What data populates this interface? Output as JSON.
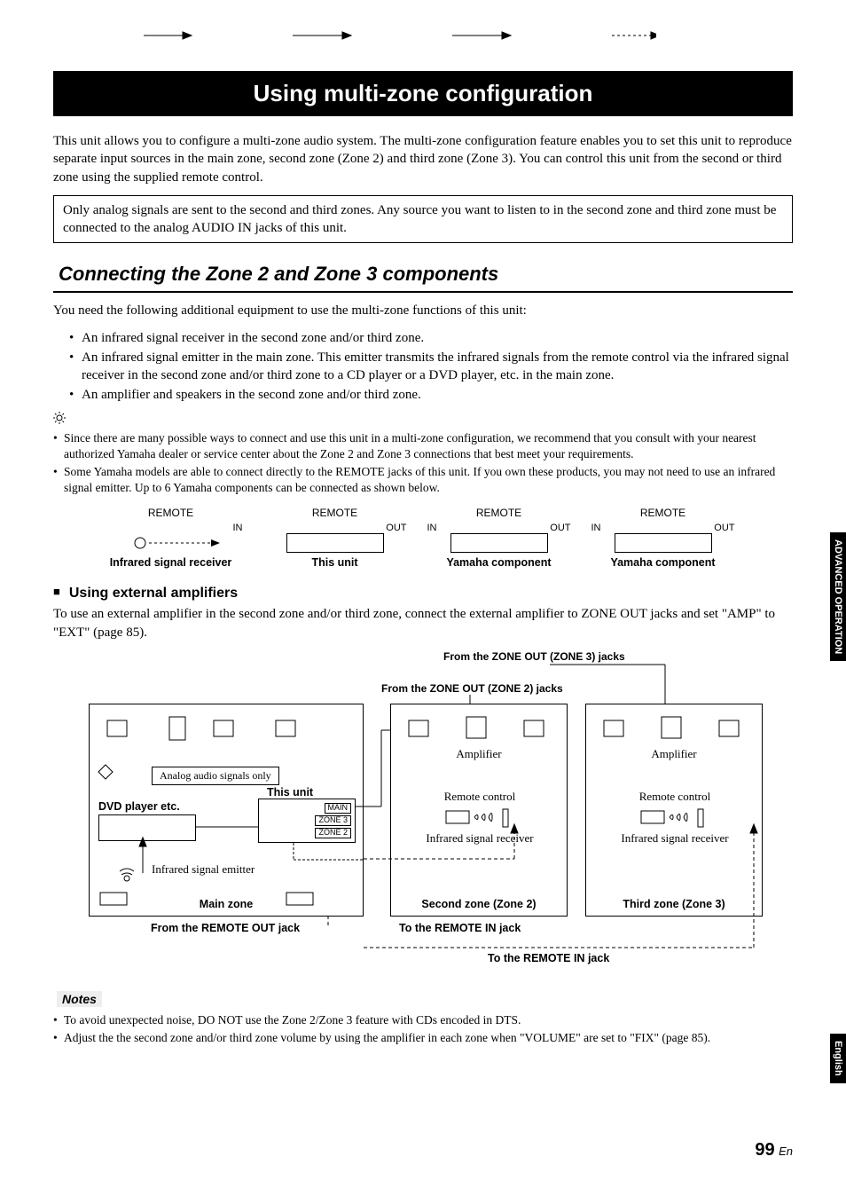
{
  "title": "Using multi-zone configuration",
  "intro": "This unit allows you to configure a multi-zone audio system. The multi-zone configuration feature enables you to set this unit to reproduce separate input sources in the main zone, second zone (Zone 2) and third zone (Zone 3). You can control this unit from the second or third zone using the supplied remote control.",
  "boxed_note": "Only analog signals are sent to the second and third zones. Any source you want to listen to in the second zone and third zone must be connected to the analog AUDIO IN jacks of this unit.",
  "section_heading": "Connecting the Zone 2 and Zone 3 components",
  "need_text": "You need the following additional equipment to use the multi-zone functions of this unit:",
  "need_bullets": [
    "An infrared signal receiver in the second zone and/or third zone.",
    "An infrared signal emitter in the main zone. This emitter transmits the infrared signals from the remote control via the infrared signal receiver in the second zone and/or third zone to a CD player or a DVD player, etc. in the main zone.",
    "An amplifier and speakers in the second zone and/or third zone."
  ],
  "tip_bullets": [
    "Since there are many possible ways to connect and use this unit in a multi-zone configuration, we recommend that you consult with your nearest authorized Yamaha dealer or service center about the Zone 2 and Zone 3 connections that best meet your requirements.",
    "Some Yamaha models are able to connect directly to the REMOTE jacks of this unit. If you own these products, you may not need to use an infrared signal emitter. Up to 6 Yamaha components can be connected as shown below."
  ],
  "remote_diag": {
    "label": "REMOTE",
    "in": "IN",
    "out": "OUT",
    "items": [
      "Infrared signal receiver",
      "This unit",
      "Yamaha component",
      "Yamaha component"
    ]
  },
  "sub_heading": "Using external amplifiers",
  "sub_text": "To use an external amplifier in the second zone and/or third zone, connect the external amplifier to ZONE OUT jacks and set \"AMP\" to \"EXT\" (page 85).",
  "big": {
    "zone3_jacks": "From the ZONE OUT (ZONE 3) jacks",
    "zone2_jacks": "From the ZONE OUT (ZONE 2) jacks",
    "amplifier": "Amplifier",
    "remote_control": "Remote control",
    "ir_receiver": "Infrared signal receiver",
    "second_zone": "Second zone (Zone 2)",
    "third_zone": "Third zone (Zone 3)",
    "analog_only": "Analog audio signals only",
    "this_unit": "This unit",
    "main": "MAIN",
    "zone3": "ZONE 3",
    "zone2": "ZONE 2",
    "dvd": "DVD player etc.",
    "ir_emitter": "Infrared signal emitter",
    "main_zone": "Main zone",
    "from_remote_out": "From the REMOTE OUT jack",
    "to_remote_in": "To the REMOTE IN jack",
    "to_remote_in2": "To the REMOTE IN jack"
  },
  "notes_label": "Notes",
  "notes": [
    "To avoid unexpected noise, DO NOT use the Zone 2/Zone 3 feature with CDs encoded in DTS.",
    "Adjust the the second zone and/or third zone volume by using the amplifier in each zone when \"VOLUME\" are set to \"FIX\" (page 85)."
  ],
  "tabs": {
    "advanced": "ADVANCED OPERATION",
    "english": "English"
  },
  "page_num": "99",
  "page_suffix": "En"
}
